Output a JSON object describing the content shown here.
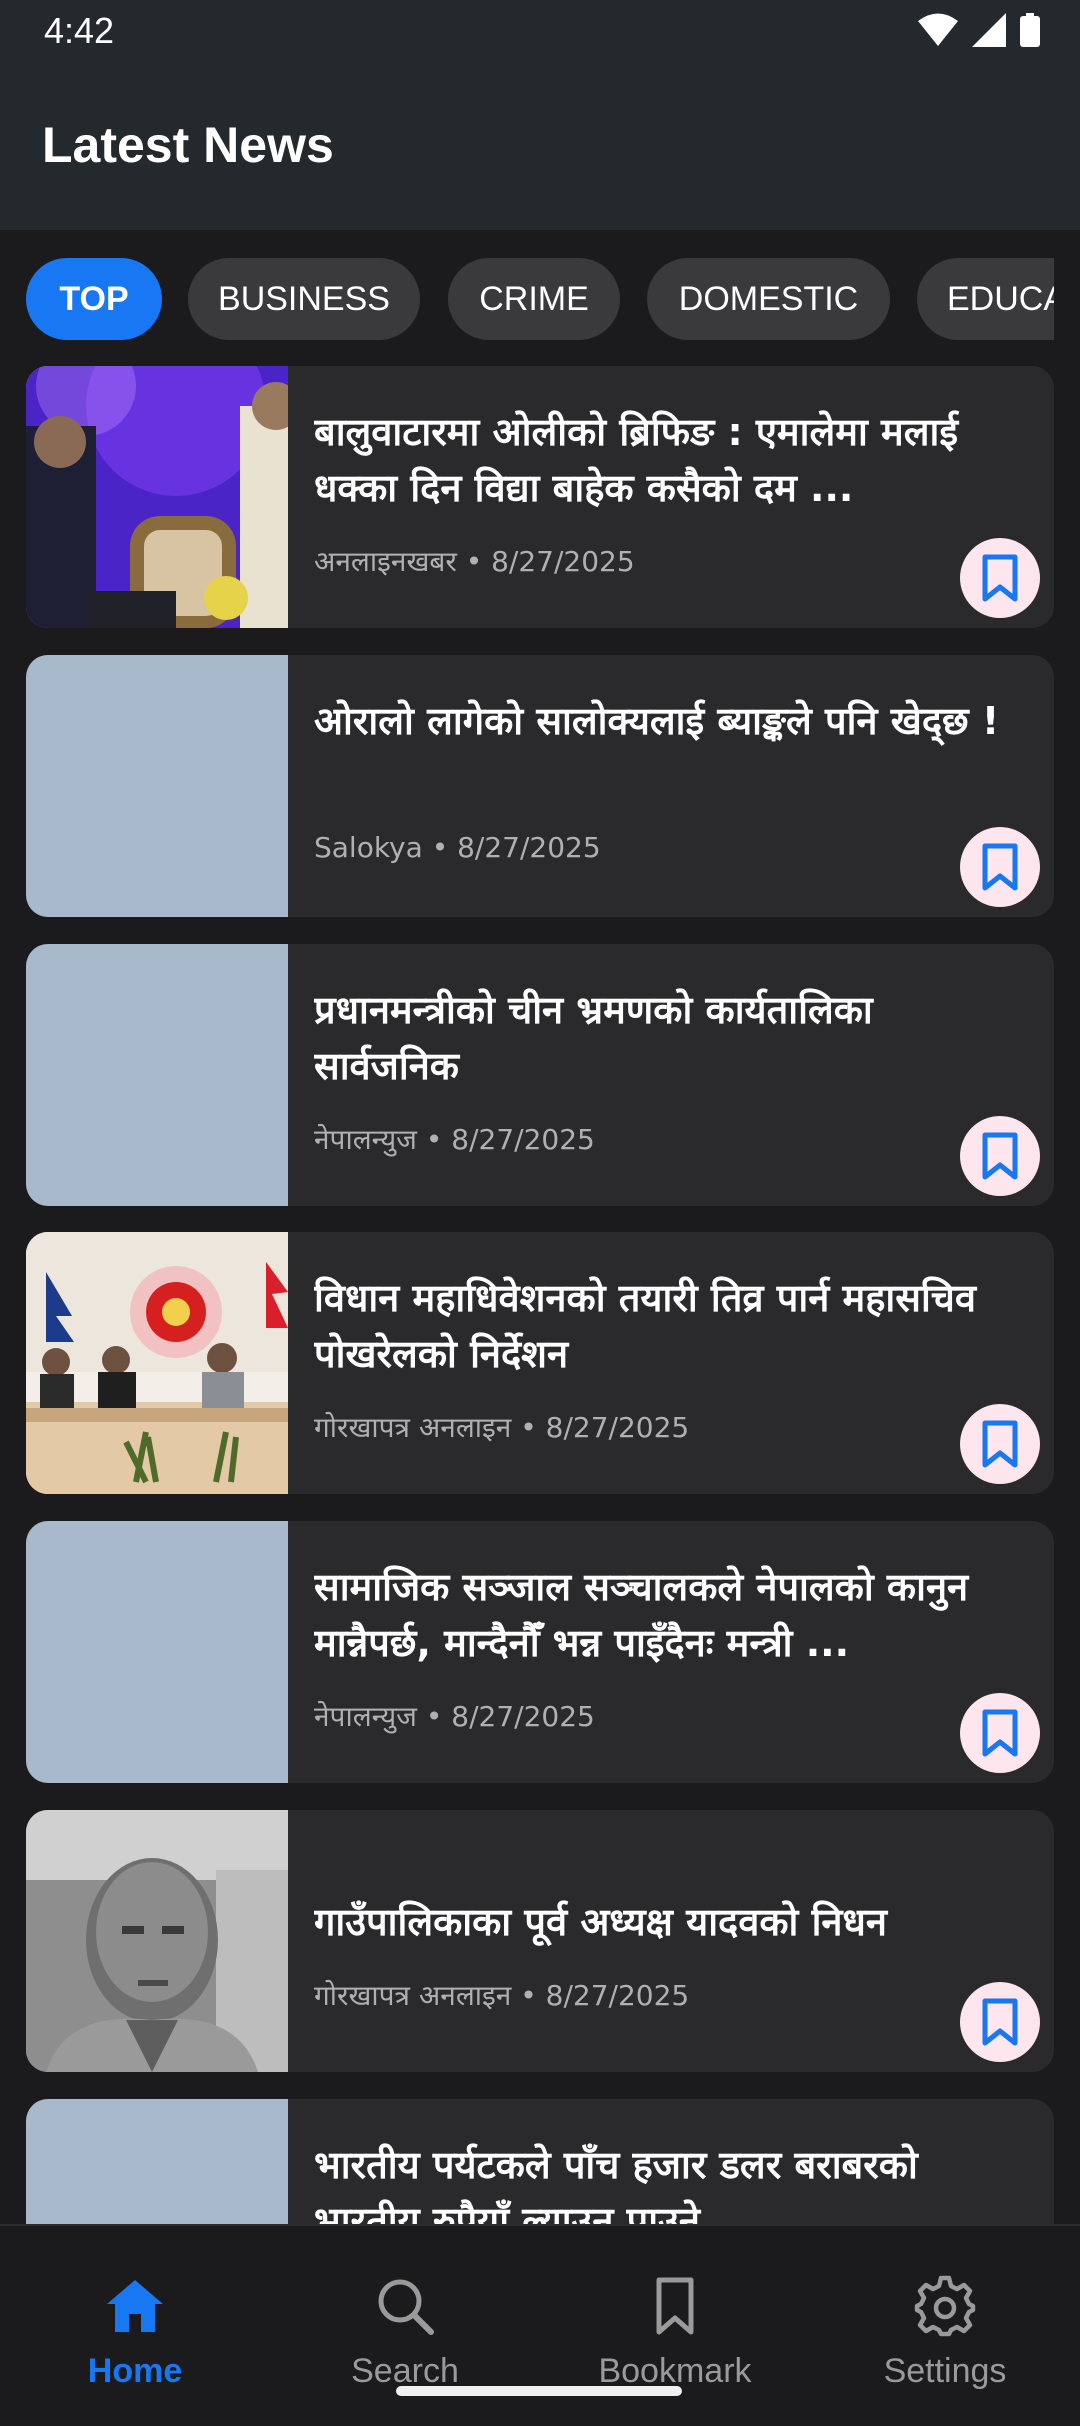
{
  "status": {
    "time": "4:42"
  },
  "appbar": {
    "title": "Latest News"
  },
  "categories": [
    {
      "label": "TOP",
      "active": true
    },
    {
      "label": "BUSINESS",
      "active": false
    },
    {
      "label": "CRIME",
      "active": false
    },
    {
      "label": "DOMESTIC",
      "active": false
    },
    {
      "label": "EDUCATION",
      "active": false
    }
  ],
  "articles": [
    {
      "title": "बालुवाटारमा ओलीको ब्रिफिङ : एमालेमा मलाई धक्का दिन विद्या बाहेक कसैको दम ...",
      "source": "अनलाइनखबर",
      "date": "8/27/2025",
      "meta": "अनलाइनखबर • 8/27/2025",
      "image": "photo-stage"
    },
    {
      "title": "ओरालो लागेको सालोक्यलाई ब्याङ्कले पनि खेद्छ !",
      "source": "Salokya",
      "date": "8/27/2025",
      "meta": "Salokya • 8/27/2025",
      "image": "placeholder"
    },
    {
      "title": "प्रधानमन्त्रीको चीन भ्रमणको कार्यतालिका सार्वजनिक",
      "source": "नेपालन्युज",
      "date": "8/27/2025",
      "meta": "नेपालन्युज • 8/27/2025",
      "image": "placeholder"
    },
    {
      "title": "विधान महाधिवेशनको तयारी तिव्र पार्न महासचिव पोखरेलको निर्देशन",
      "source": "गोरखापत्र अनलाइन",
      "date": "8/27/2025",
      "meta": "गोरखापत्र अनलाइन • 8/27/2025",
      "image": "photo-meeting"
    },
    {
      "title": "सामाजिक सञ्जाल सञ्चालकले नेपालको कानुन मान्नैपर्छ, मान्दैनौँ भन्न पाइँदैनः मन्त्री ...",
      "source": "नेपालन्युज",
      "date": "8/27/2025",
      "meta": "नेपालन्युज • 8/27/2025",
      "image": "placeholder"
    },
    {
      "title": "गाउँपालिकाका पूर्व अध्यक्ष यादवको निधन",
      "source": "गोरखापत्र अनलाइन",
      "date": "8/27/2025",
      "meta": "गोरखापत्र अनलाइन • 8/27/2025",
      "image": "photo-portrait"
    },
    {
      "title": "भारतीय पर्यटकले पाँच हजार डलर बराबरको भारतीय रुपैयाँ ल्याउन पाउने",
      "source": "",
      "date": "",
      "meta": "",
      "image": "placeholder"
    }
  ],
  "bottom_nav": [
    {
      "label": "Home",
      "icon": "home-icon",
      "active": true
    },
    {
      "label": "Search",
      "icon": "search-icon",
      "active": false
    },
    {
      "label": "Bookmark",
      "icon": "bookmark-icon",
      "active": false
    },
    {
      "label": "Settings",
      "icon": "gear-icon",
      "active": false
    }
  ],
  "colors": {
    "accent": "#1877f2",
    "card": "#2a2a2d",
    "background": "#1b1b1d",
    "bookmark_button": "#fde6ee",
    "bookmark_icon": "#1877f2"
  }
}
